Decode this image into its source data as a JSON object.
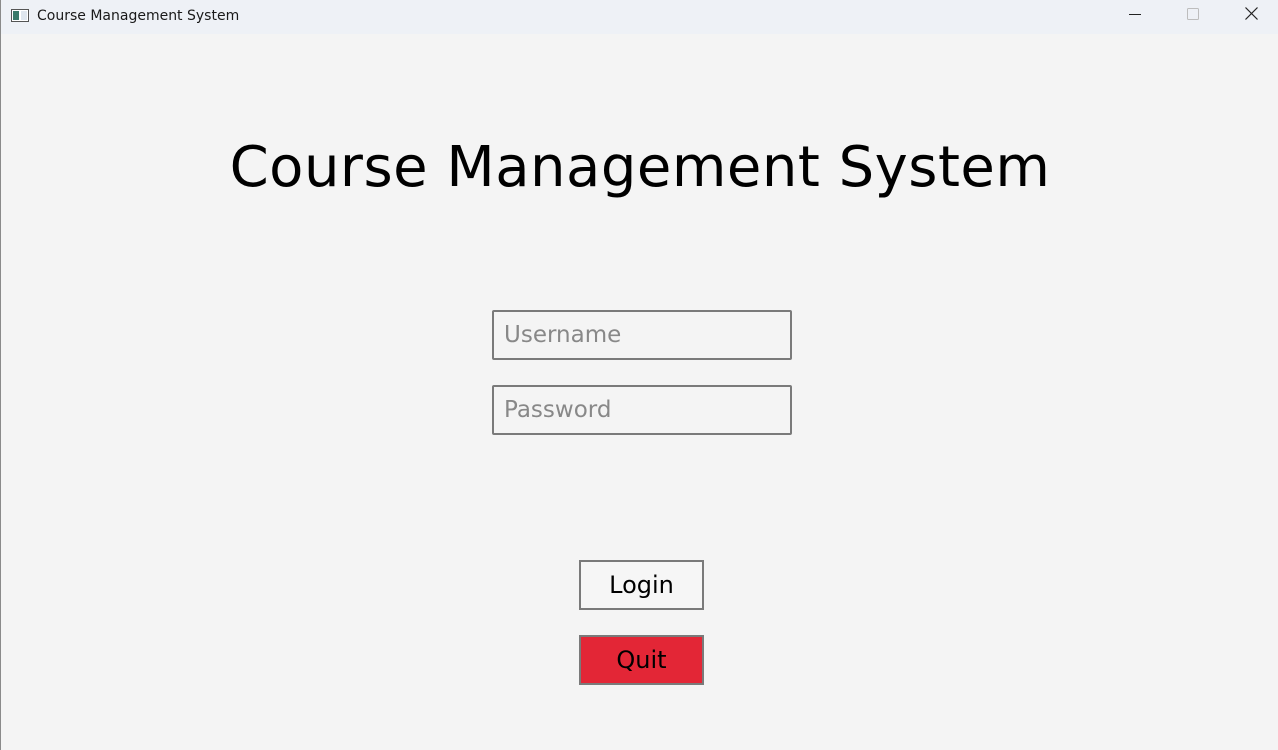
{
  "window": {
    "title": "Course Management System"
  },
  "main": {
    "heading": "Course Management System",
    "username": {
      "value": "",
      "placeholder": "Username"
    },
    "password": {
      "value": "",
      "placeholder": "Password"
    },
    "login_label": "Login",
    "quit_label": "Quit"
  },
  "colors": {
    "background": "#f4f4f4",
    "quit_button": "#e32636",
    "border": "#7a7a7a"
  },
  "icons": [
    "app-icon",
    "minimize-icon",
    "maximize-icon",
    "close-icon"
  ]
}
